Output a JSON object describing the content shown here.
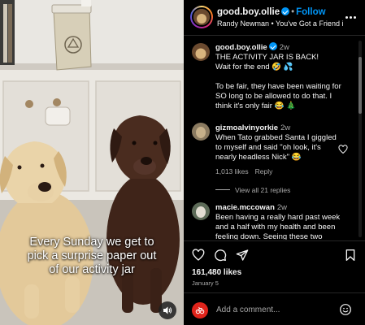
{
  "media": {
    "caption_lines": [
      "Every Sunday we get to",
      "pick a surprise paper out",
      "of our activity jar"
    ]
  },
  "header": {
    "username": "good.boy.ollie",
    "separator": "•",
    "follow_label": "Follow",
    "audio": "Randy Newman • You've Got a Friend in ..."
  },
  "post": {
    "username": "good.boy.ollie",
    "time": "2w",
    "lines": [
      "THE ACTIVITY JAR IS BACK!",
      "Wait for the end 🤣 💦",
      "",
      "To be fair, they have been waiting for",
      "SO long to be allowed to do that. I",
      "think it's only fair 😂 🎄"
    ]
  },
  "comments": [
    {
      "username": "gizmoalvinyorkie",
      "time": "2w",
      "lines": [
        "When Tato grabbed Santa I giggled",
        "to myself and said \"oh look, it's",
        "nearly headless Nick\" 😂"
      ],
      "likes": "1,013 likes",
      "reply_label": "Reply",
      "view_replies": "View all 21 replies"
    },
    {
      "username": "macie.mccowan",
      "time": "2w",
      "lines": [
        "Been having a really hard past week",
        "and a half with my health and been",
        "feeling down. Seeing these two"
      ]
    }
  ],
  "actions": {
    "likes": "161,480 likes",
    "date": "January 5"
  },
  "add_comment": {
    "placeholder": "Add a comment..."
  },
  "colors": {
    "accent": "#0095f6",
    "background": "#000000",
    "muted_text": "#a8a8a8"
  },
  "icons": [
    "heart-icon",
    "comment-icon",
    "share-icon",
    "bookmark-icon",
    "more-icon",
    "volume-icon",
    "emoji-icon",
    "verified-icon"
  ]
}
